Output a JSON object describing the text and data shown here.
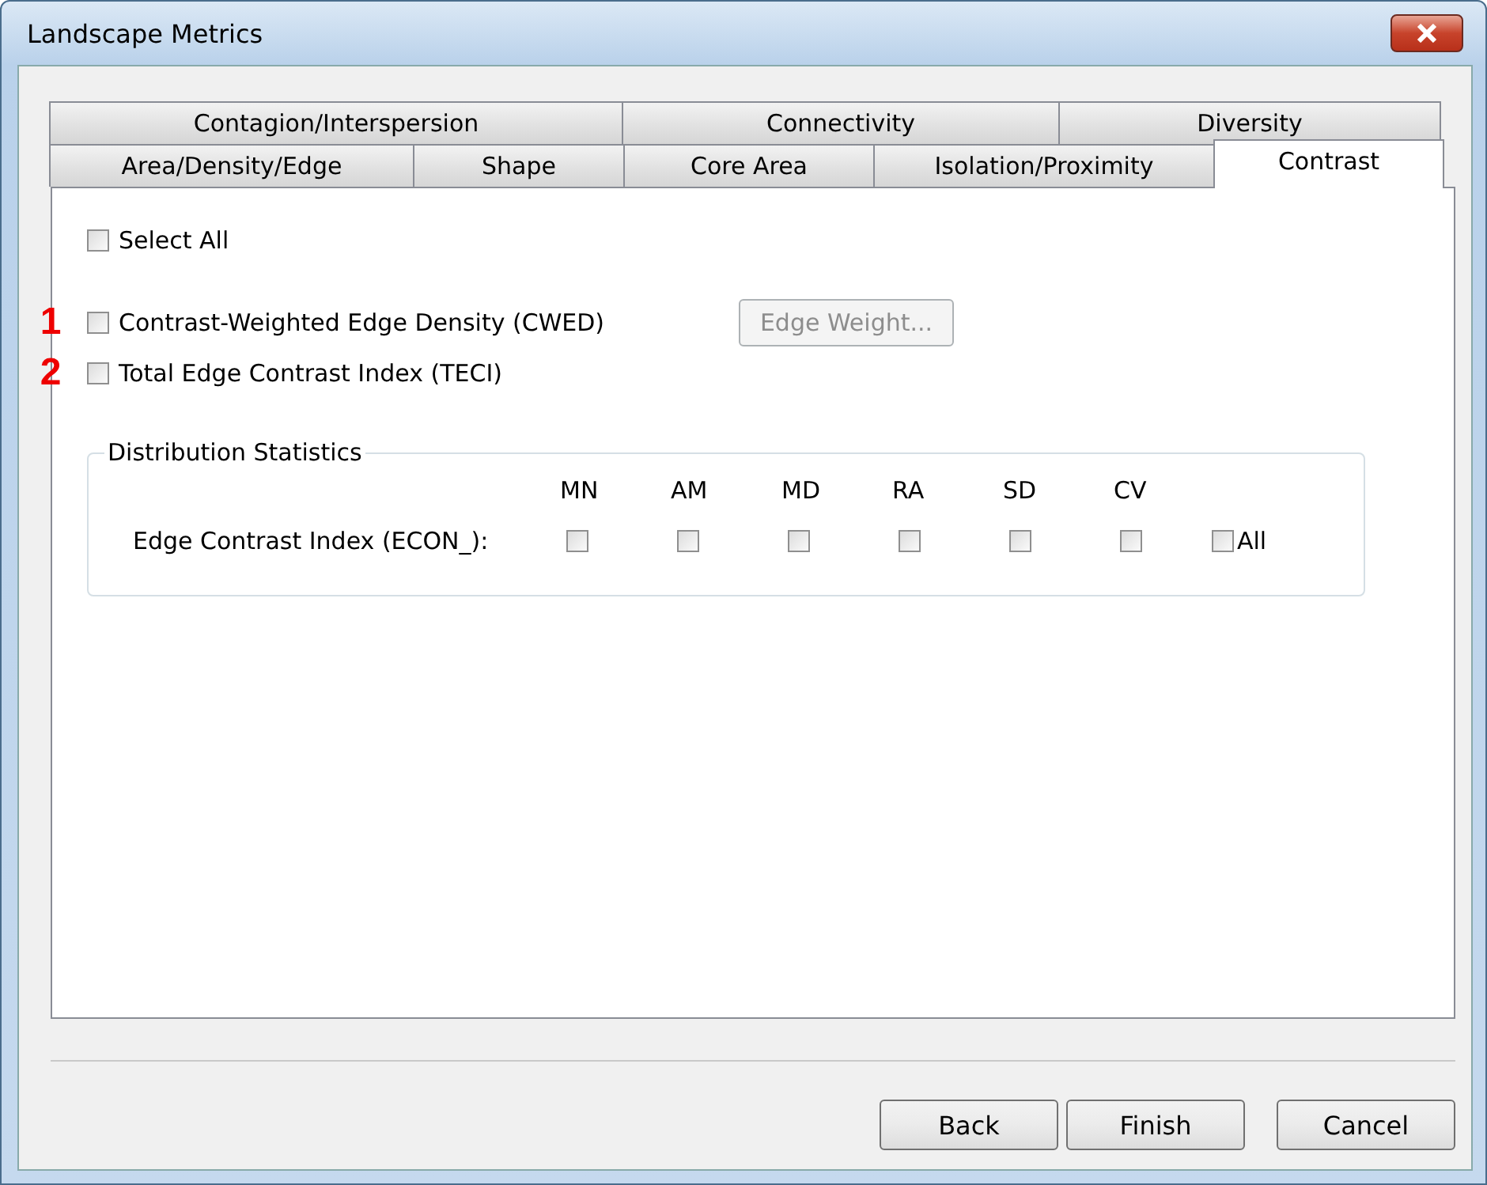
{
  "window": {
    "title": "Landscape Metrics"
  },
  "tab_rows": [
    [
      {
        "label": "Contagion/Interspersion",
        "selected": false
      },
      {
        "label": "Connectivity",
        "selected": false
      },
      {
        "label": "Diversity",
        "selected": false
      }
    ],
    [
      {
        "label": "Area/Density/Edge",
        "selected": false
      },
      {
        "label": "Shape",
        "selected": false
      },
      {
        "label": "Core Area",
        "selected": false
      },
      {
        "label": "Isolation/Proximity",
        "selected": false
      },
      {
        "label": "Contrast",
        "selected": true
      }
    ]
  ],
  "select_all": {
    "label": "Select All",
    "checked": false
  },
  "metrics": [
    {
      "annotation": "1",
      "label": "Contrast-Weighted Edge Density (CWED)",
      "checked": false,
      "button": {
        "label": "Edge Weight...",
        "disabled": true
      }
    },
    {
      "annotation": "2",
      "label": "Total Edge Contrast Index (TECI)",
      "checked": false
    }
  ],
  "distribution": {
    "title": "Distribution Statistics",
    "columns": [
      "MN",
      "AM",
      "MD",
      "RA",
      "SD",
      "CV"
    ],
    "rows": [
      {
        "label": "Edge Contrast Index (ECON_):",
        "checks": [
          false,
          false,
          false,
          false,
          false,
          false
        ],
        "all": {
          "label": "All",
          "checked": false
        }
      }
    ]
  },
  "buttons": [
    {
      "label": "Back"
    },
    {
      "label": "Finish"
    },
    {
      "label": "Cancel"
    }
  ]
}
